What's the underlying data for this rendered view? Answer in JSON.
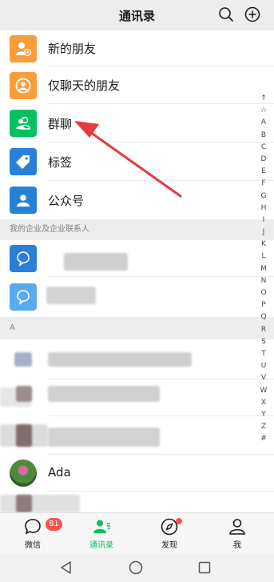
{
  "header": {
    "title": "通讯录",
    "search_icon": "search-icon",
    "add_icon": "plus-circle-icon"
  },
  "top_items": [
    {
      "label": "新的朋友",
      "icon": "add-friend-icon",
      "color": "#fa9d3b"
    },
    {
      "label": "仅聊天的朋友",
      "icon": "chat-only-friend-icon",
      "color": "#fa9d3b"
    },
    {
      "label": "群聊",
      "icon": "group-chat-icon",
      "color": "#07c160"
    },
    {
      "label": "标签",
      "icon": "tag-icon",
      "color": "#2782d7"
    },
    {
      "label": "公众号",
      "icon": "official-account-icon",
      "color": "#2782d7"
    }
  ],
  "enterprise_section": {
    "title": "我的企业及企业联系人"
  },
  "section_a": {
    "title": "A"
  },
  "contact_ada": {
    "name": "Ada"
  },
  "index_letters": [
    "↑",
    "☆",
    "A",
    "B",
    "C",
    "D",
    "E",
    "F",
    "G",
    "H",
    "I",
    "J",
    "K",
    "L",
    "M",
    "N",
    "O",
    "P",
    "Q",
    "R",
    "S",
    "T",
    "U",
    "V",
    "W",
    "X",
    "Y",
    "Z",
    "#"
  ],
  "tabbar": {
    "tabs": [
      {
        "label": "微信",
        "icon": "chat-bubble-icon",
        "badge": "81",
        "active": false
      },
      {
        "label": "通讯录",
        "icon": "contacts-icon",
        "active": true
      },
      {
        "label": "发现",
        "icon": "compass-icon",
        "dot": true,
        "active": false
      },
      {
        "label": "我",
        "icon": "person-icon",
        "active": false
      }
    ]
  },
  "system_nav": {
    "back": "back-triangle-icon",
    "home": "home-circle-icon",
    "recents": "recents-square-icon"
  },
  "annotation": {
    "arrow_color": "#e8393c"
  },
  "colors": {
    "accent": "#07c160",
    "orange": "#fa9d3b",
    "blue": "#2782d7",
    "badge_red": "#fa5151"
  }
}
